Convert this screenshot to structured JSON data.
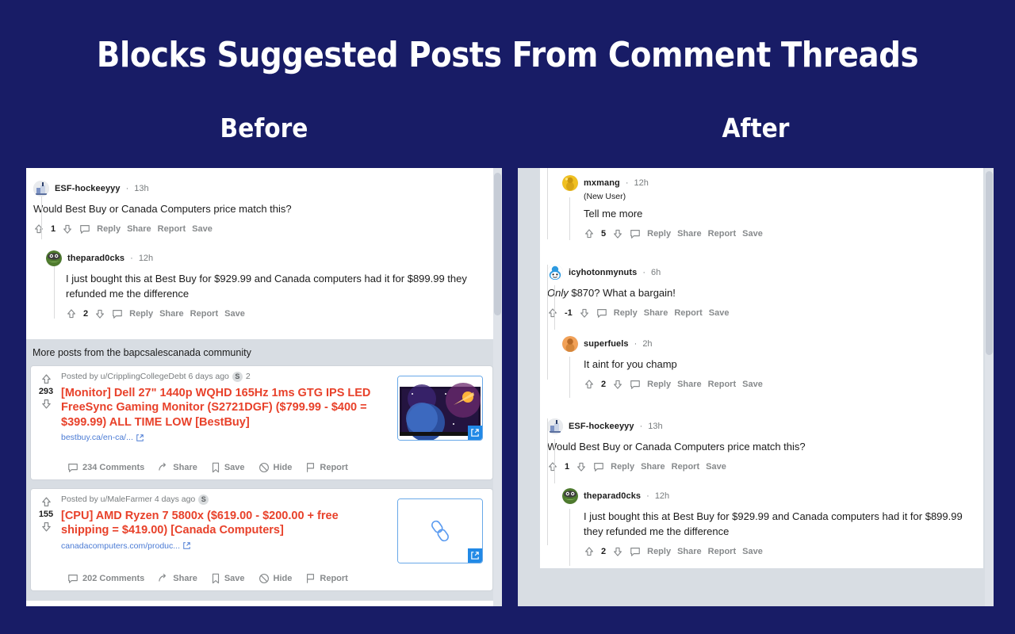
{
  "heading": {
    "title": "Blocks Suggested Posts From Comment Threads",
    "before_label": "Before",
    "after_label": "After"
  },
  "colors": {
    "background": "#181c66",
    "panel_gray": "#d8dde3",
    "post_title_red": "#e8412a",
    "link_blue": "#4b7bd4",
    "meta_gray": "#787c7e"
  },
  "actions": {
    "reply": "Reply",
    "share": "Share",
    "report": "Report",
    "save": "Save",
    "hide": "Hide"
  },
  "before": {
    "comments": [
      {
        "user": "ESF-hockeeyyy",
        "sep": "·",
        "age": "13h",
        "body": "Would Best Buy or Canada Computers price match this?",
        "score": "1",
        "avatar": "avatar-hockey"
      },
      {
        "user": "theparad0cks",
        "sep": "·",
        "age": "12h",
        "body": "I just bought this at Best Buy for $929.99 and Canada computers had it for $899.99 they refunded me the difference",
        "score": "2",
        "avatar": "avatar-pepe"
      }
    ],
    "more_posts": {
      "header": "More posts from the bapcsalescanada community",
      "posts": [
        {
          "score": "293",
          "posted_by": "Posted by u/CripplingCollegeDebt 6 days ago",
          "award_count": "2",
          "award_icon": "silver-award-icon",
          "title": "[Monitor] Dell 27\" 1440p WQHD 165Hz 1ms GTG IPS LED FreeSync Gaming Monitor (S2721DGF) ($799.99 - $400 = $399.99) ALL TIME LOW [BestBuy]",
          "link": "bestbuy.ca/en-ca/...",
          "comments": "234 Comments",
          "thumb_type": "monitor-space-image"
        },
        {
          "score": "155",
          "posted_by": "Posted by u/MaleFarmer 4 days ago",
          "award_count": "",
          "award_icon": "silver-award-icon",
          "title": "[CPU] AMD Ryzen 7 5800x ($619.00 - $200.00 + free shipping = $419.00) [Canada Computers]",
          "link": "canadacomputers.com/produc...",
          "comments": "202 Comments",
          "thumb_type": "link-placeholder"
        }
      ]
    }
  },
  "after": {
    "comments": [
      {
        "user": "mxmang",
        "sep": "·",
        "age": "12h",
        "flair": "(New User)",
        "body": "Tell me more",
        "score": "5",
        "avatar": "avatar-yellow",
        "indent": 1
      },
      {
        "user": "icyhotonmynuts",
        "sep": "·",
        "age": "6h",
        "body_italic": "Only",
        "body": " $870? What a bargain!",
        "score": "-1",
        "avatar": "avatar-snoo",
        "indent": 0
      },
      {
        "user": "superfuels",
        "sep": "·",
        "age": "2h",
        "body": "It aint for you champ",
        "score": "2",
        "avatar": "avatar-orange",
        "indent": 1
      },
      {
        "user": "ESF-hockeeyyy",
        "sep": "·",
        "age": "13h",
        "body": "Would Best Buy or Canada Computers price match this?",
        "score": "1",
        "avatar": "avatar-hockey",
        "indent": 0
      },
      {
        "user": "theparad0cks",
        "sep": "·",
        "age": "12h",
        "body": "I just bought this at Best Buy for $929.99 and Canada computers had it for $899.99 they refunded me the difference",
        "score": "2",
        "avatar": "avatar-pepe",
        "indent": 1
      }
    ]
  }
}
